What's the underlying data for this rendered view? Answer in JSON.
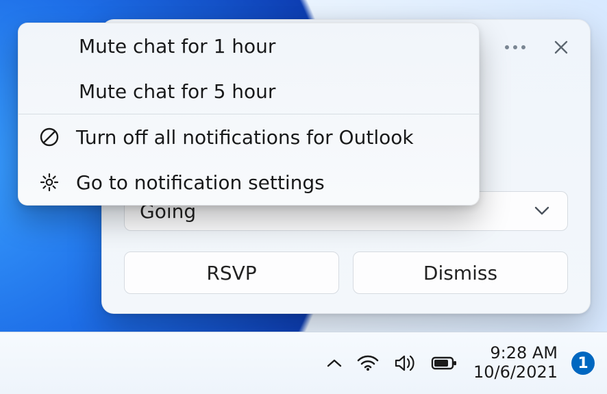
{
  "context_menu": {
    "items": [
      {
        "label": "Mute chat for 1 hour",
        "icon": null
      },
      {
        "label": "Mute chat for 5 hour",
        "icon": null
      },
      {
        "label": "Turn off all notifications for Outlook",
        "icon": "block-icon"
      },
      {
        "label": "Go to notification settings",
        "icon": "gear-icon"
      }
    ]
  },
  "notification": {
    "select_value": "Going",
    "buttons": {
      "rsvp": "RSVP",
      "dismiss": "Dismiss"
    }
  },
  "taskbar": {
    "time": "9:28 AM",
    "date": "10/6/2021",
    "badge_count": "1"
  }
}
